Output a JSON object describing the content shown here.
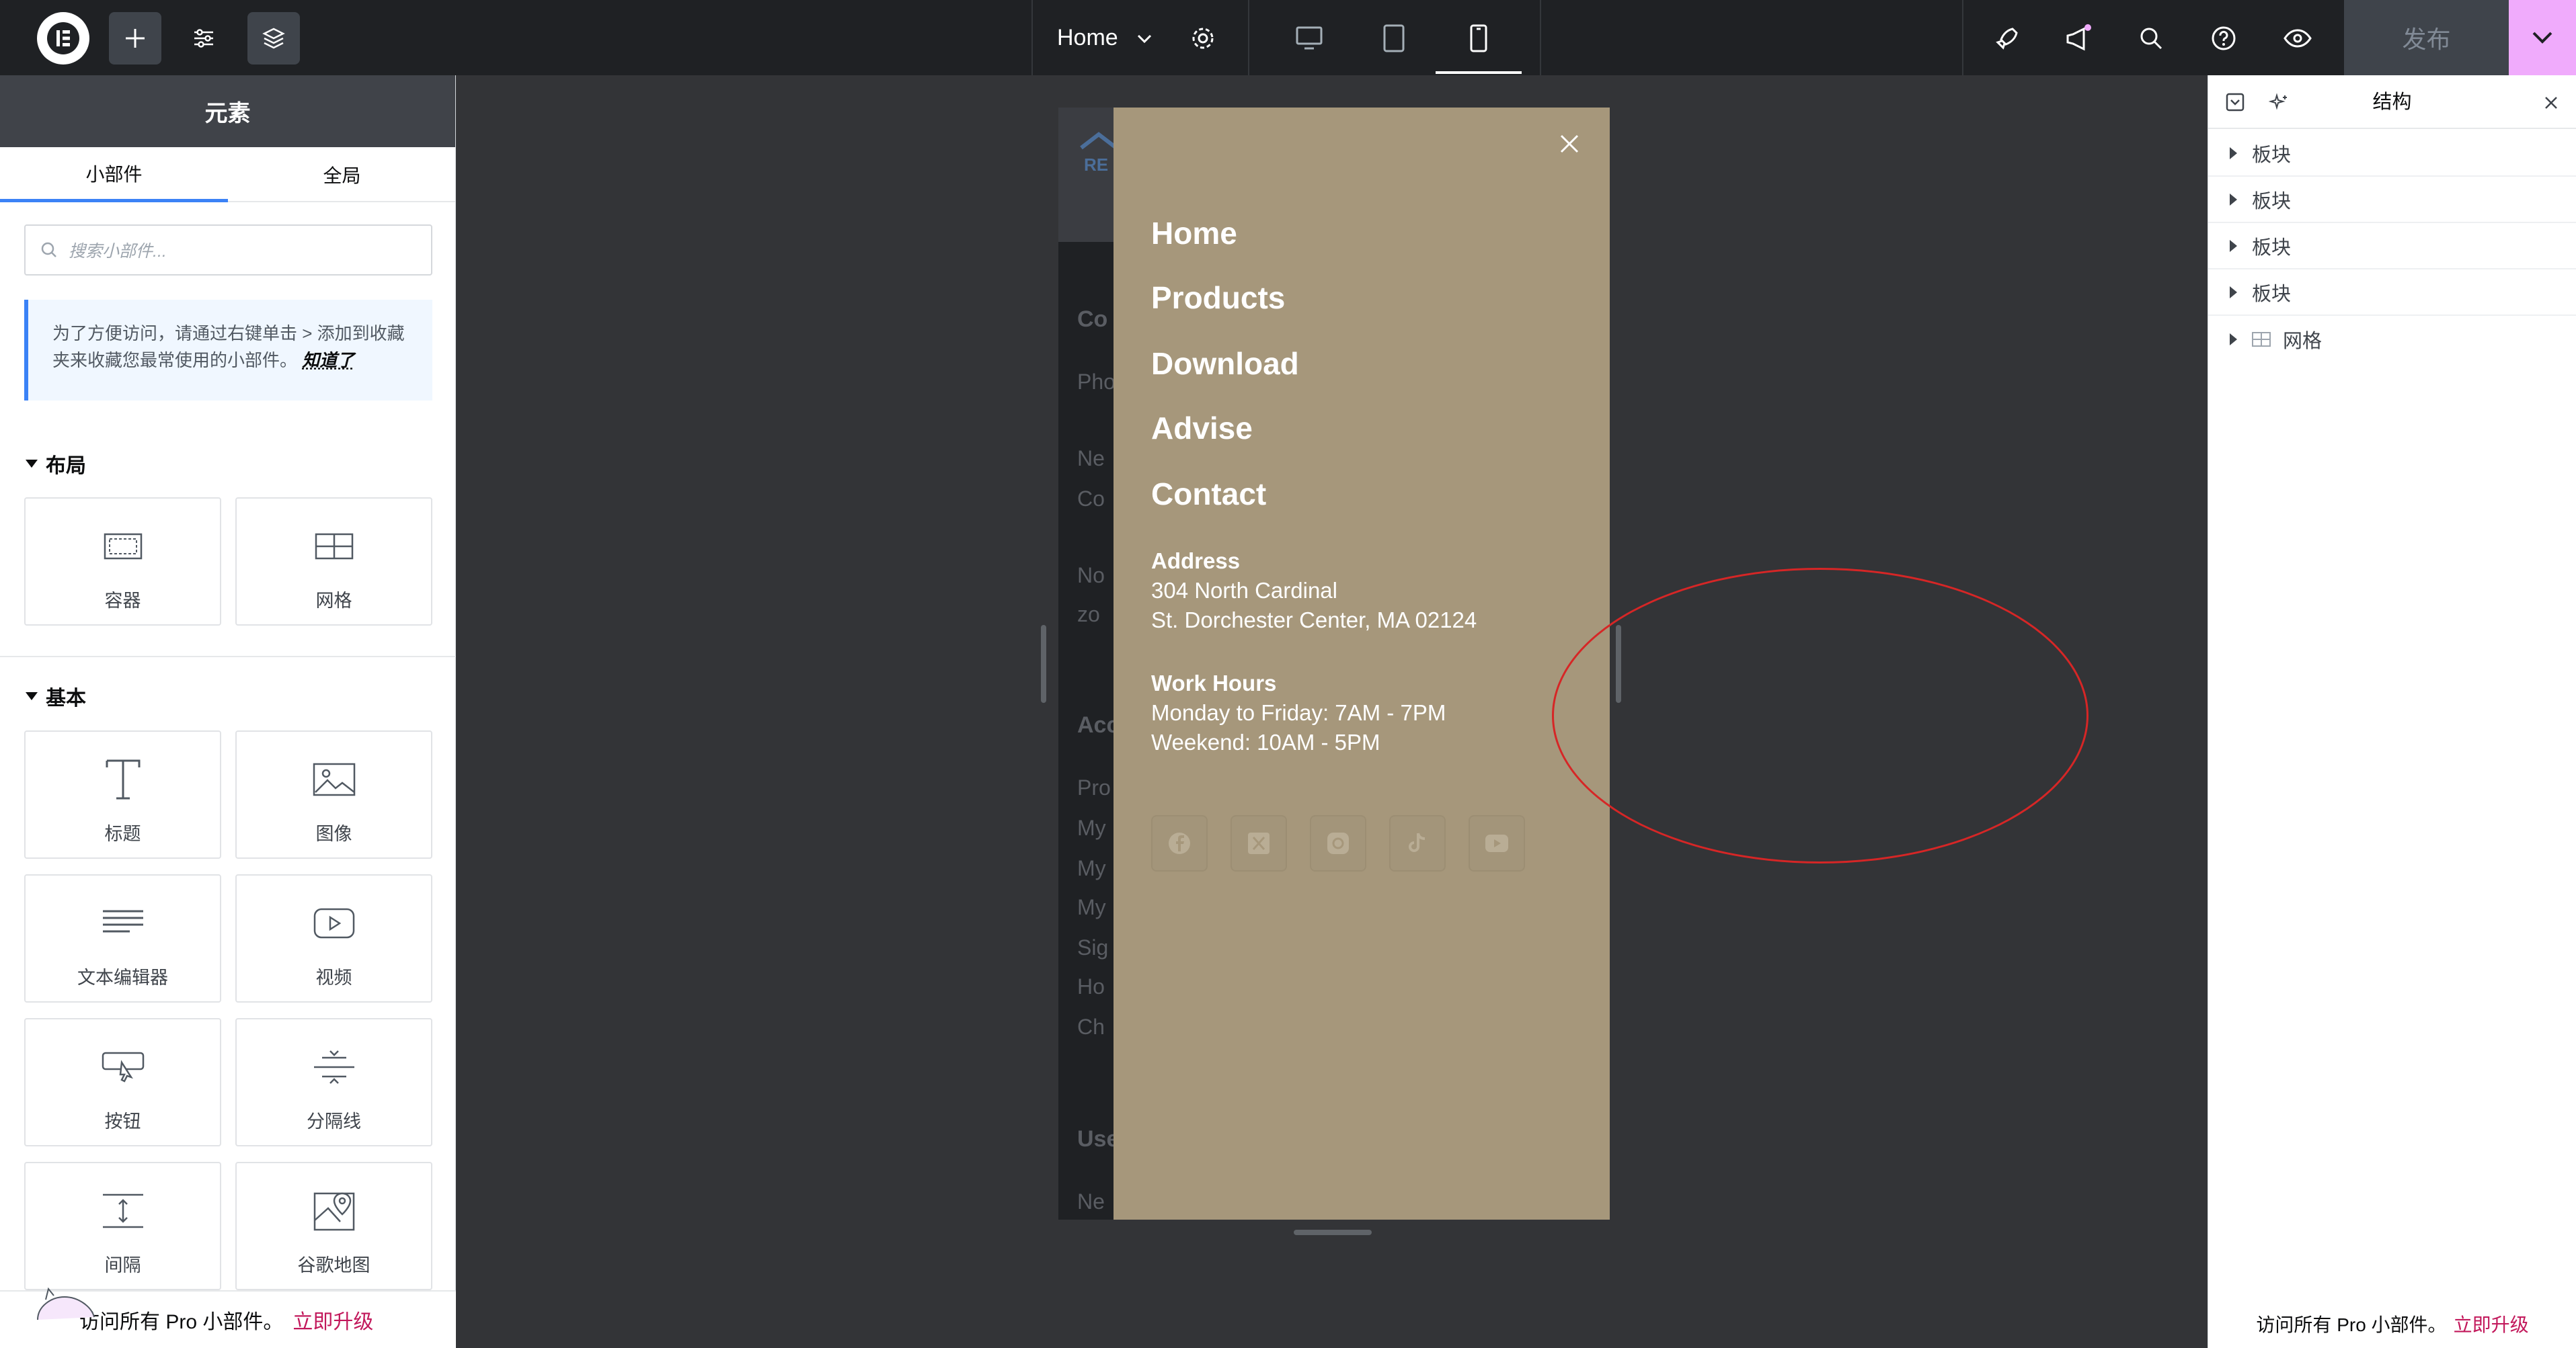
{
  "topbar": {
    "page_name": "Home",
    "publish_label": "发布"
  },
  "left_panel": {
    "header_title": "元素",
    "tabs": [
      {
        "label": "小部件"
      },
      {
        "label": "全局"
      }
    ],
    "search": {
      "placeholder": "搜索小部件..."
    },
    "notice": {
      "text": "为了方便访问，请通过右键单击 > 添加到收藏夹来收藏您最常使用的小部件。",
      "link": "知道了"
    },
    "categories": [
      {
        "title": "布局",
        "widgets": [
          {
            "label": "容器",
            "icon": "container-icon"
          },
          {
            "label": "网格",
            "icon": "grid-icon"
          }
        ]
      },
      {
        "title": "基本",
        "widgets": [
          {
            "label": "标题",
            "icon": "heading-icon"
          },
          {
            "label": "图像",
            "icon": "image-icon"
          },
          {
            "label": "文本编辑器",
            "icon": "text-editor-icon"
          },
          {
            "label": "视频",
            "icon": "video-icon"
          },
          {
            "label": "按钮",
            "icon": "button-icon"
          },
          {
            "label": "分隔线",
            "icon": "divider-icon"
          },
          {
            "label": "间隔",
            "icon": "spacer-icon"
          },
          {
            "label": "谷歌地图",
            "icon": "google-maps-icon"
          }
        ]
      }
    ],
    "footer": {
      "text": "访问所有 Pro 小部件。",
      "link": "立即升级"
    }
  },
  "canvas": {
    "menu_items": [
      "Home",
      "Products",
      "Download",
      "Advise",
      "Contact"
    ],
    "address": {
      "title": "Address",
      "lines": [
        "304 North Cardinal",
        "St. Dorchester Center, MA 02124"
      ]
    },
    "hours": {
      "title": "Work Hours",
      "lines": [
        "Monday to Friday: 7AM - 7PM",
        "Weekend: 10AM - 5PM"
      ]
    },
    "socials": [
      "facebook-icon",
      "x-icon",
      "instagram-icon",
      "tiktok-icon",
      "youtube-icon"
    ],
    "bg_ghost": {
      "logo_text": "RE",
      "h1": "Co",
      "l1": "Pho",
      "l2": "Ne",
      "l3": "Co",
      "l4": "No",
      "l5": "zo",
      "h2": "Acc",
      "a1": "Pro",
      "a2": "My",
      "a3": "My",
      "a4": "My",
      "a5": "Sig",
      "a6": "Ho",
      "a7": "Ch",
      "h3": "Use",
      "u1": "Ne"
    },
    "colors": {
      "menu_bg": "#a6977b",
      "canvas_bg": "#333437",
      "annotation": "#d62626"
    }
  },
  "right_panel": {
    "title": "结构",
    "items": [
      {
        "label": "板块"
      },
      {
        "label": "板块"
      },
      {
        "label": "板块"
      },
      {
        "label": "板块"
      },
      {
        "label": "网格"
      }
    ],
    "footer": {
      "text": "访问所有 Pro 小部件。",
      "link": "立即升级"
    }
  }
}
